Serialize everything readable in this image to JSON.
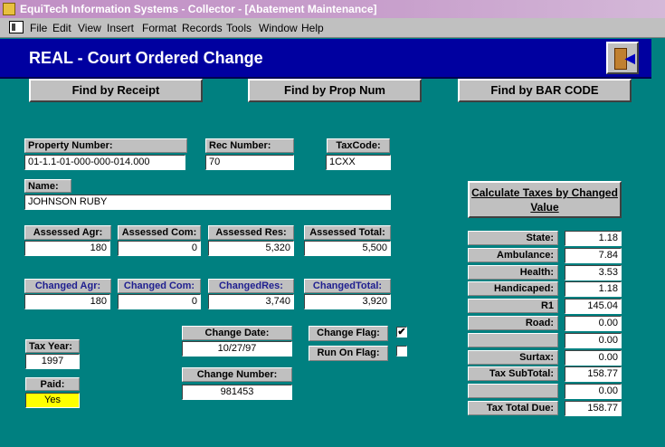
{
  "window": {
    "title": "EquiTech Information Systems - Collector - [Abatement Maintenance]"
  },
  "menu": [
    "File",
    "Edit",
    "View",
    "Insert",
    "Format",
    "Records",
    "Tools",
    "Window",
    "Help"
  ],
  "header": {
    "title": "REAL - Court Ordered Change"
  },
  "buttons": {
    "find_receipt": "Find by Receipt",
    "find_prop": "Find by Prop Num",
    "find_barcode": "Find by BAR CODE",
    "calculate": "Calculate Taxes by Changed Value"
  },
  "fields": {
    "property_number": {
      "label": "Property Number:",
      "value": "01-1.1-01-000-000-014.000"
    },
    "rec_number": {
      "label": "Rec Number:",
      "value": "70"
    },
    "taxcode": {
      "label": "TaxCode:",
      "value": "1CXX"
    },
    "name": {
      "label": "Name:",
      "value": "JOHNSON RUBY"
    },
    "assessed_agr": {
      "label": "Assessed Agr:",
      "value": "180"
    },
    "assessed_com": {
      "label": "Assessed Com:",
      "value": "0"
    },
    "assessed_res": {
      "label": "Assessed Res:",
      "value": "5,320"
    },
    "assessed_total": {
      "label": "Assessed Total:",
      "value": "5,500"
    },
    "changed_agr": {
      "label": "Changed Agr:",
      "value": "180"
    },
    "changed_com": {
      "label": "Changed Com:",
      "value": "0"
    },
    "changed_res": {
      "label": "ChangedRes:",
      "value": "3,740"
    },
    "changed_total": {
      "label": "ChangedTotal:",
      "value": "3,920"
    },
    "tax_year": {
      "label": "Tax Year:",
      "value": "1997"
    },
    "paid": {
      "label": "Paid:",
      "value": "Yes"
    },
    "change_date": {
      "label": "Change Date:",
      "value": "10/27/97"
    },
    "change_number": {
      "label": "Change Number:",
      "value": "981453"
    },
    "change_flag": {
      "label": "Change Flag:",
      "checked": true,
      "mark": "✔"
    },
    "run_on_flag": {
      "label": "Run On Flag:",
      "checked": false,
      "mark": ""
    }
  },
  "taxes": [
    {
      "label": "State:",
      "value": "1.18"
    },
    {
      "label": "Ambulance:",
      "value": "7.84"
    },
    {
      "label": "Health:",
      "value": "3.53"
    },
    {
      "label": "Handicaped:",
      "value": "1.18"
    },
    {
      "label": "R1",
      "value": "145.04"
    },
    {
      "label": "Road:",
      "value": "0.00"
    },
    {
      "label": "",
      "value": "0.00"
    },
    {
      "label": "Surtax:",
      "value": "0.00"
    },
    {
      "label": "Tax SubTotal:",
      "value": "158.77"
    },
    {
      "label": "",
      "value": "0.00"
    },
    {
      "label": "Tax Total Due:",
      "value": "158.77"
    }
  ]
}
